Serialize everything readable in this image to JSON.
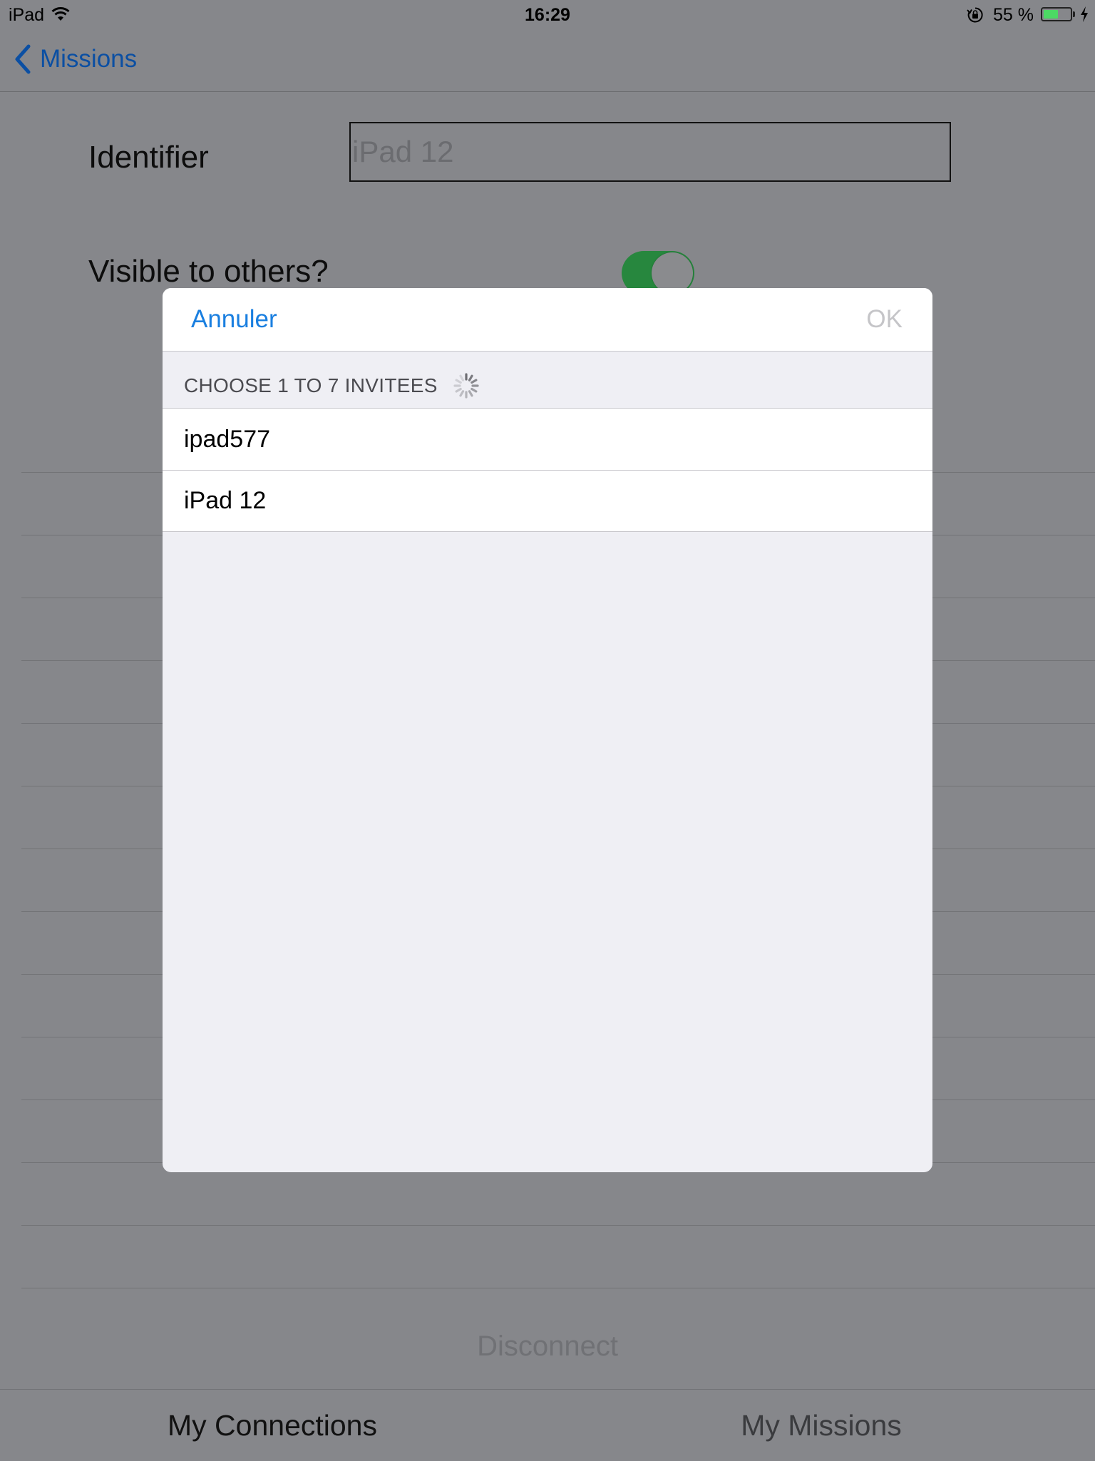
{
  "status_bar": {
    "carrier": "iPad",
    "time": "16:29",
    "battery_percent": "55 %",
    "battery_level": 0.55,
    "icons": [
      "wifi-icon",
      "orientation-lock-icon",
      "battery-icon",
      "charging-bolt-icon"
    ]
  },
  "nav": {
    "back_label": "Missions"
  },
  "form": {
    "identifier_label": "Identifier",
    "identifier_placeholder": "iPad 12",
    "visible_label": "Visible to others?",
    "visible_on": true
  },
  "disconnect_label": "Disconnect",
  "tabs": [
    {
      "label": "My Connections",
      "selected": true
    },
    {
      "label": "My Missions",
      "selected": false
    }
  ],
  "modal": {
    "cancel_label": "Annuler",
    "ok_label": "OK",
    "section_header": "CHOOSE 1 TO 7 INVITEES",
    "invitees": [
      "ipad577",
      "iPad 12"
    ]
  },
  "colors": {
    "dim_background": "#86878b",
    "link_blue": "#1a7fe0",
    "toggle_green": "#27873e",
    "modal_background": "#efeff4"
  }
}
